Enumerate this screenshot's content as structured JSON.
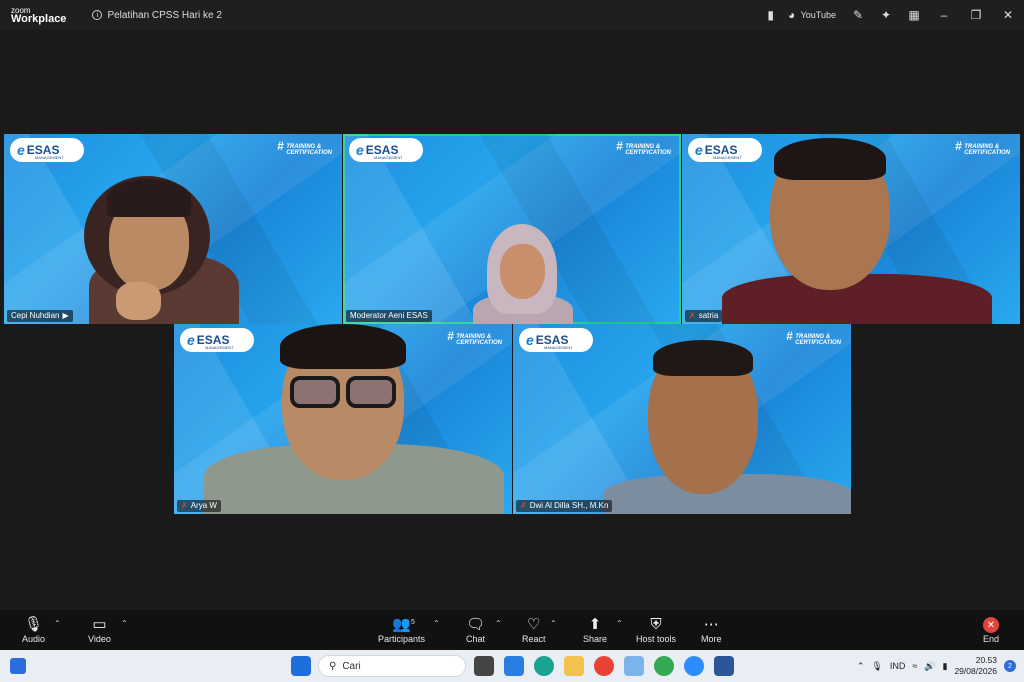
{
  "app": {
    "brand_top": "zoom",
    "brand_bottom": "Workplace",
    "meeting_title": "Pelatihan CPSS Hari ke 2",
    "stream_label": "YouTube"
  },
  "colors": {
    "active_speaker": "#23d18b",
    "end": "#e0443a",
    "tile_bg": "#1d8fe0"
  },
  "tile_branding": {
    "logo_e": "e",
    "logo_text": "ESAS",
    "logo_sub": "MANAGEMENT",
    "hashtag": "#",
    "tag_line1": "TRAINING &",
    "tag_line2": "CERTIFICATION"
  },
  "participants": [
    {
      "name": "Cepi Nuhdian",
      "suffix": "▶",
      "muted": false,
      "active": false
    },
    {
      "name": "Moderator Aeni ESAS",
      "suffix": "",
      "muted": false,
      "active": true
    },
    {
      "name": "satria",
      "suffix": "",
      "muted": true,
      "active": false
    },
    {
      "name": "Arya W",
      "suffix": "",
      "muted": true,
      "active": false
    },
    {
      "name": "Dwi Al Dilla SH., M.Kn",
      "suffix": "",
      "muted": true,
      "active": false
    }
  ],
  "toolbar": {
    "audio": "Audio",
    "video": "Video",
    "participants": "Participants",
    "participants_count": "5",
    "chat": "Chat",
    "react": "React",
    "share": "Share",
    "host_tools": "Host tools",
    "more": "More",
    "end": "End"
  },
  "taskbar": {
    "search_placeholder": "Cari",
    "language": "IND",
    "time": "20.53",
    "date": "29/08/2026",
    "notifications": "2"
  }
}
